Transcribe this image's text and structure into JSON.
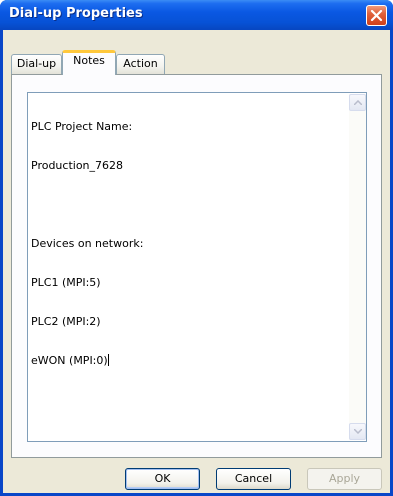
{
  "window": {
    "title": "Dial-up Properties"
  },
  "tabs": [
    {
      "label": "Dial-up",
      "active": false
    },
    {
      "label": "Notes",
      "active": true
    },
    {
      "label": "Action",
      "active": false
    }
  ],
  "notes": {
    "lines": [
      "PLC Project Name:",
      "Production_7628",
      "",
      "Devices on network:",
      "PLC1 (MPI:5)",
      "PLC2 (MPI:2)",
      "eWON (MPI:0)"
    ]
  },
  "buttons": {
    "ok": "OK",
    "cancel": "Cancel",
    "apply": "Apply"
  },
  "icons": {
    "close": "close-icon",
    "scroll_up": "arrow-up-icon",
    "scroll_down": "arrow-down-icon"
  },
  "colors": {
    "titlebar": "#0a58e3",
    "dialog_face": "#ece9d8",
    "close_button": "#e0623c",
    "active_tab_highlight": "#ffc83c"
  }
}
